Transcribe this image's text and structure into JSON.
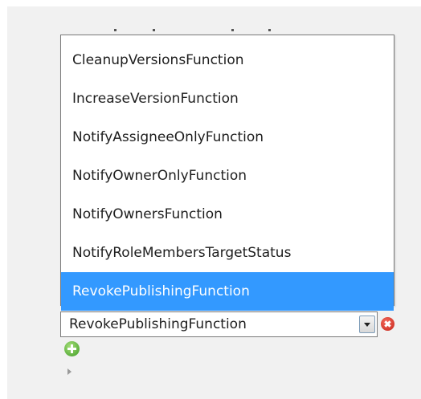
{
  "dropdown": {
    "options": [
      "CleanupVersionsFunction",
      "IncreaseVersionFunction",
      "NotifyAssigneeOnlyFunction",
      "NotifyOwnerOnlyFunction",
      "NotifyOwnersFunction",
      "NotifyRoleMembersTargetStatus",
      "RevokePublishingFunction"
    ],
    "highlighted_option": "RevokePublishingFunction"
  },
  "select": {
    "value": "RevokePublishingFunction"
  },
  "icons": {
    "select_arrow": "chevron-down-icon",
    "remove": "remove-circle-icon",
    "add": "add-circle-icon",
    "expand": "triangle-right-icon"
  },
  "colors": {
    "highlight": "#3399ff",
    "remove": "#c52419",
    "add": "#3c9a22",
    "background": "#f1f1f1"
  }
}
